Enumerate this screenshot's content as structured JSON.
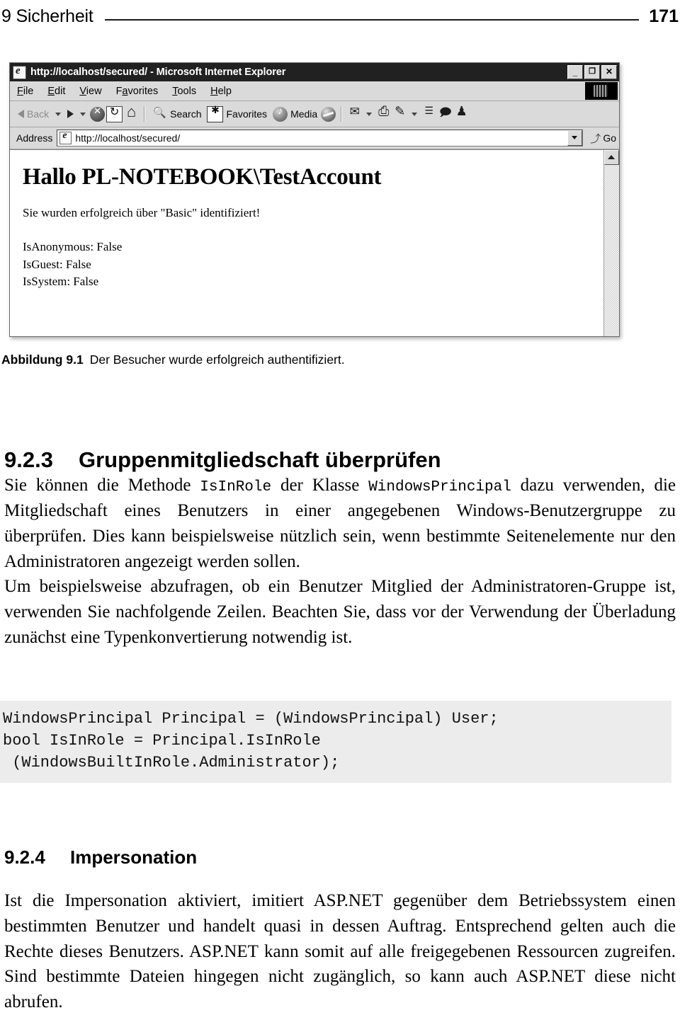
{
  "running_head": {
    "chapter": "9 Sicherheit",
    "page_number": "171"
  },
  "figure": {
    "caption_number": "Abbildung 9.1",
    "caption_text": "Der Besucher wurde erfolgreich authentifiziert.",
    "browser": {
      "window_title": "http://localhost/secured/ - Microsoft Internet Explorer",
      "window_buttons": {
        "minimize": "_",
        "maximize": "❐",
        "close": "✕"
      },
      "menu": [
        {
          "pre": "",
          "key": "F",
          "post": "ile"
        },
        {
          "pre": "",
          "key": "E",
          "post": "dit"
        },
        {
          "pre": "",
          "key": "V",
          "post": "iew"
        },
        {
          "pre": "F",
          "key": "a",
          "post": "vorites"
        },
        {
          "pre": "",
          "key": "T",
          "post": "ools"
        },
        {
          "pre": "",
          "key": "H",
          "post": "elp"
        }
      ],
      "toolbar": {
        "back_label": "Back",
        "search_label": "Search",
        "favorites_label": "Favorites",
        "media_label": "Media"
      },
      "address": {
        "label": "Address",
        "url": "http://localhost/secured/",
        "go_label": "Go",
        "go_arrow": "⤴"
      },
      "page": {
        "heading": "Hallo PL-NOTEBOOK\\TestAccount",
        "message": "Sie wurden erfolgreich über \"Basic\" identifiziert!",
        "flags": [
          "IsAnonymous: False",
          "IsGuest: False",
          "IsSystem: False"
        ]
      }
    }
  },
  "sections": [
    {
      "number": "9.2.3",
      "title": "Gruppenmitgliedschaft überprüfen",
      "paragraphs": [
        {
          "runs": [
            {
              "t": "text",
              "v": "Sie können die Methode "
            },
            {
              "t": "code",
              "v": "IsInRole"
            },
            {
              "t": "text",
              "v": " der Klasse "
            },
            {
              "t": "code",
              "v": "WindowsPrincipal"
            },
            {
              "t": "text",
              "v": " dazu verwenden, die Mitgliedschaft eines Benutzers in einer angegebenen Windows-Benutzergruppe zu überprüfen. Dies kann beispielsweise nützlich sein, wenn bestimmte Seitenelemente nur den Administratoren angezeigt werden sollen."
            }
          ]
        },
        {
          "runs": [
            {
              "t": "text",
              "v": "Um beispielsweise abzufragen, ob ein Benutzer Mitglied der Administratoren-Gruppe ist, verwenden Sie nachfolgende Zeilen. Beachten Sie, dass vor der Verwendung der Überladung zunächst eine Typenkonvertierung notwendig ist."
            }
          ]
        }
      ],
      "code_block": [
        "WindowsPrincipal Principal = (WindowsPrincipal) User;",
        "bool IsInRole = Principal.IsInRole",
        " (WindowsBuiltInRole.Administrator);"
      ]
    },
    {
      "number": "9.2.4",
      "title": "Impersonation",
      "paragraphs": [
        {
          "runs": [
            {
              "t": "text",
              "v": "Ist die Impersonation aktiviert, imitiert ASP.NET gegenüber dem Betriebssystem einen bestimmten Benutzer und handelt quasi in dessen Auftrag. Entsprechend gelten auch die Rechte dieses Benutzers. ASP.NET kann somit auf alle freigegebenen Ressourcen zugreifen. Sind bestimmte Dateien hingegen nicht zugänglich, so kann auch ASP.NET diese nicht abrufen."
            }
          ]
        }
      ]
    }
  ]
}
